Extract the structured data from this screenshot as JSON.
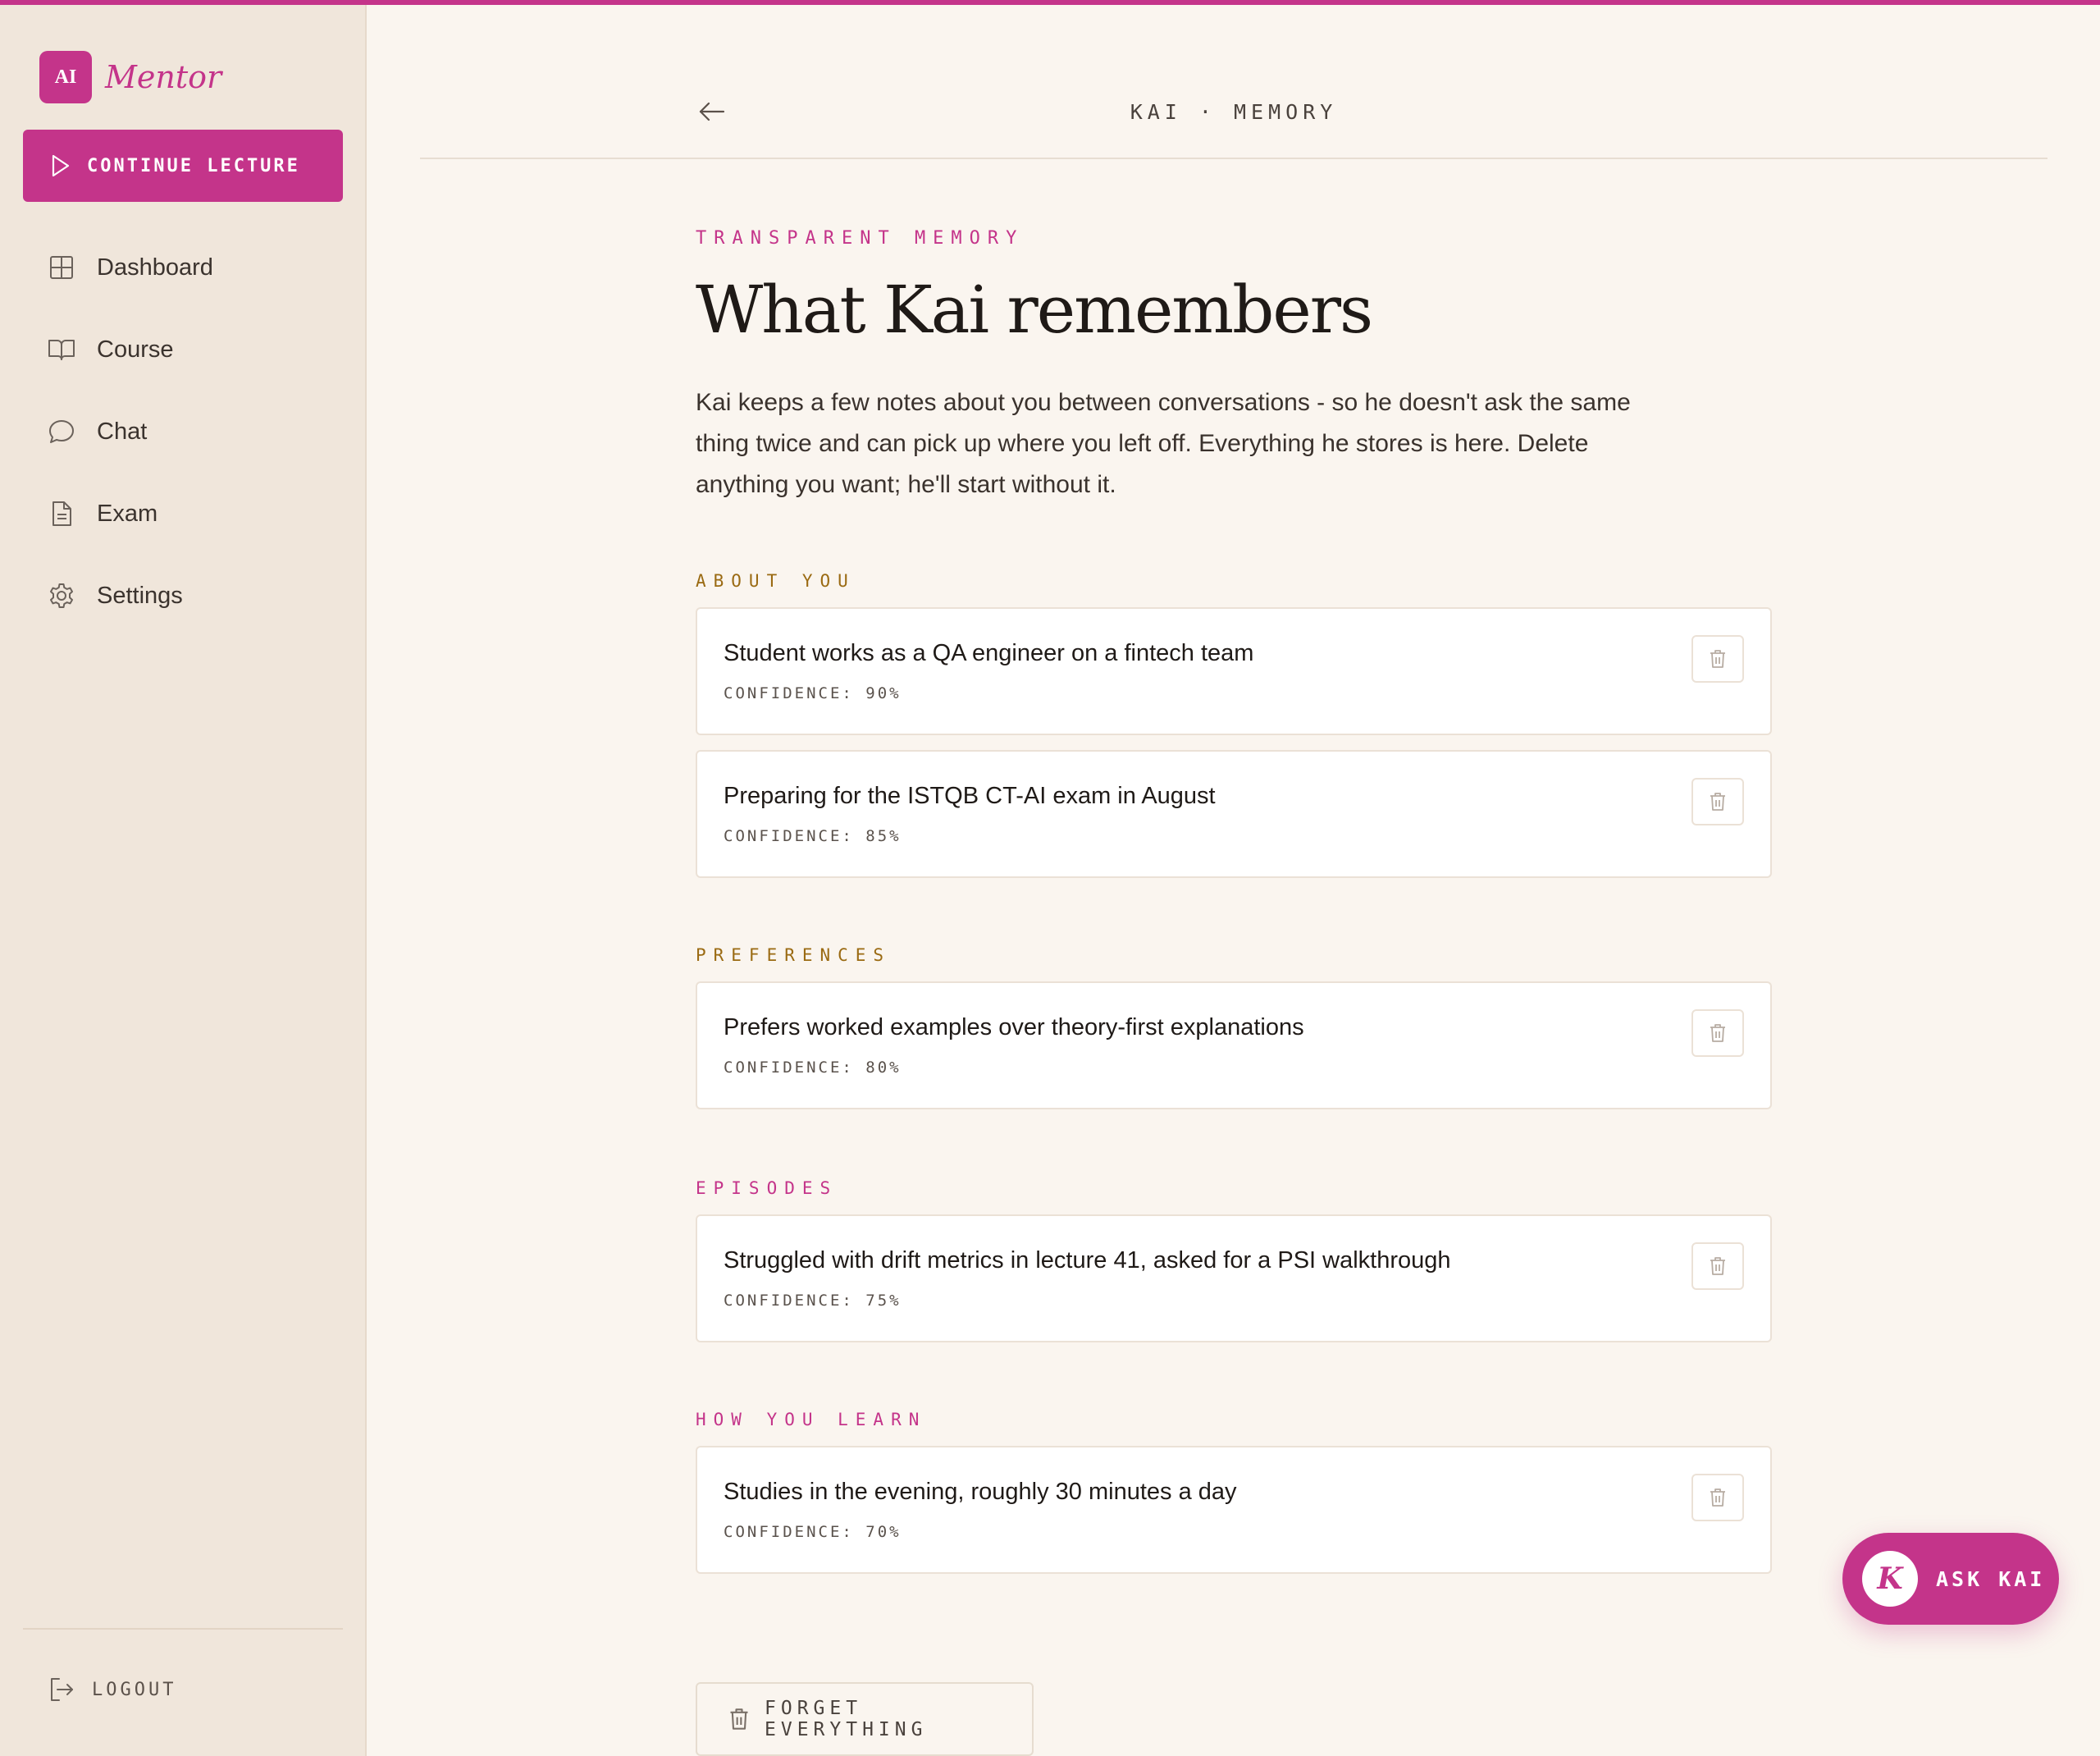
{
  "brand": {
    "mark": "AI",
    "name": "Mentor"
  },
  "sidebar": {
    "continue_label": "CONTINUE LECTURE",
    "items": [
      {
        "label": "Dashboard",
        "icon": "grid-icon"
      },
      {
        "label": "Course",
        "icon": "book-icon"
      },
      {
        "label": "Chat",
        "icon": "chat-bubble-icon"
      },
      {
        "label": "Exam",
        "icon": "document-icon"
      },
      {
        "label": "Settings",
        "icon": "gear-icon"
      }
    ],
    "logout_label": "LOGOUT"
  },
  "header": {
    "title": "KAI · MEMORY"
  },
  "page": {
    "eyebrow": "TRANSPARENT MEMORY",
    "title": "What Kai remembers",
    "intro": "Kai keeps a few notes about you between conversations - so he doesn't ask the same thing twice and can pick up where you left off. Everything he stores is here. Delete anything you want; he'll start without it."
  },
  "sections": [
    {
      "label": "ABOUT YOU",
      "color": "#9a6a12",
      "memories": [
        {
          "text": "Student works as a QA engineer on a fintech team",
          "confidence": "CONFIDENCE: 90%"
        },
        {
          "text": "Preparing for the ISTQB CT-AI exam in August",
          "confidence": "CONFIDENCE: 85%"
        }
      ]
    },
    {
      "label": "PREFERENCES",
      "color": "#9a6a12",
      "memories": [
        {
          "text": "Prefers worked examples over theory-first explanations",
          "confidence": "CONFIDENCE: 80%"
        }
      ]
    },
    {
      "label": "EPISODES",
      "color": "#c4348a",
      "memories": [
        {
          "text": "Struggled with drift metrics in lecture 41, asked for a PSI walkthrough",
          "confidence": "CONFIDENCE: 75%"
        }
      ]
    },
    {
      "label": "HOW YOU LEARN",
      "color": "#c4348a",
      "memories": [
        {
          "text": "Studies in the evening, roughly 30 minutes a day",
          "confidence": "CONFIDENCE: 70%"
        }
      ]
    }
  ],
  "forget_label": "FORGET EVERYTHING",
  "ask": {
    "avatar_letter": "K",
    "label": "ASK KAI"
  },
  "colors": {
    "accent": "#c4348a",
    "amber": "#9a6a12",
    "sidebar_bg": "#f0e6db",
    "page_bg": "#faf5ef"
  }
}
